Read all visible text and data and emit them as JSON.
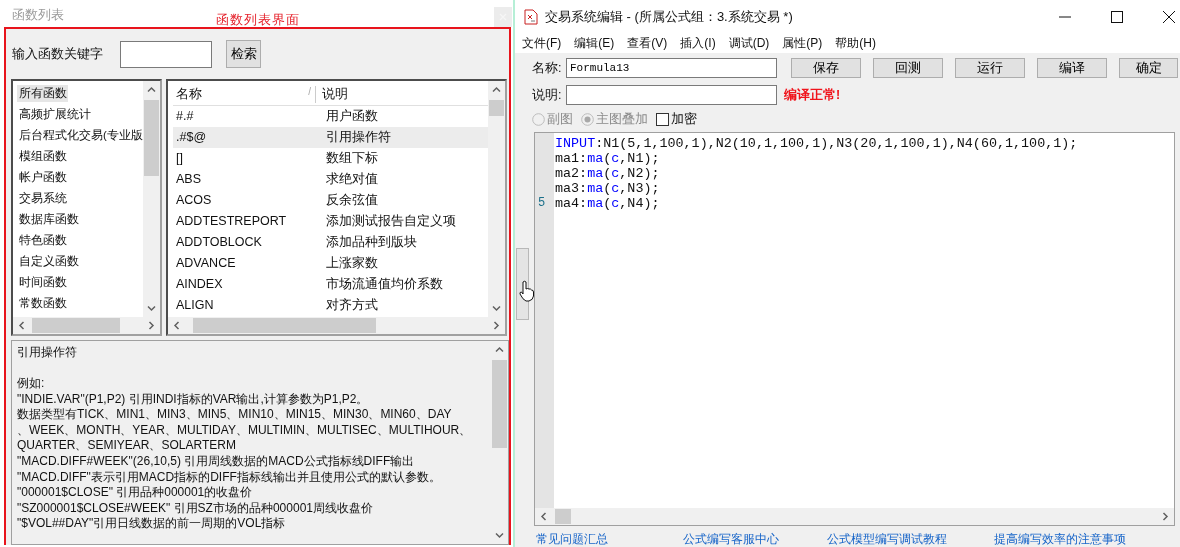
{
  "left_panel": {
    "title": "函数列表",
    "annotation": "函数列表界面",
    "search": {
      "label": "输入函数关键字",
      "button": "检索"
    },
    "categories": [
      {
        "label": "所有函数",
        "selected": true
      },
      {
        "label": "高频扩展统计",
        "selected": false
      },
      {
        "label": "后台程式化交易(专业版",
        "selected": false
      },
      {
        "label": "模组函数",
        "selected": false
      },
      {
        "label": "帐户函数",
        "selected": false
      },
      {
        "label": "交易系统",
        "selected": false
      },
      {
        "label": "数据库函数",
        "selected": false
      },
      {
        "label": "特色函数",
        "selected": false
      },
      {
        "label": "自定义函数",
        "selected": false
      },
      {
        "label": "时间函数",
        "selected": false
      },
      {
        "label": "常数函数",
        "selected": false
      }
    ],
    "functions": {
      "columns": [
        "名称",
        "说明"
      ],
      "sort_mark": "/",
      "rows": [
        {
          "name": "#.#",
          "description": "用户函数",
          "selected": false
        },
        {
          "name": ".#$@",
          "description": "引用操作符",
          "selected": true
        },
        {
          "name": "[]",
          "description": "数组下标",
          "selected": false
        },
        {
          "name": "ABS",
          "description": "求绝对值",
          "selected": false
        },
        {
          "name": "ACOS",
          "description": "反余弦值",
          "selected": false
        },
        {
          "name": "ADDTESTREPORT",
          "description": "添加测试报告自定义项",
          "selected": false
        },
        {
          "name": "ADDTOBLOCK",
          "description": "添加品种到版块",
          "selected": false
        },
        {
          "name": "ADVANCE",
          "description": "上涨家数",
          "selected": false
        },
        {
          "name": "AINDEX",
          "description": "市场流通值均价系数",
          "selected": false
        },
        {
          "name": "ALIGN",
          "description": "对齐方式",
          "selected": false
        }
      ]
    },
    "description": {
      "heading": "引用操作符",
      "lines": [
        "例如:",
        "\"INDIE.VAR\"(P1,P2) 引用INDI指标的VAR输出,计算参数为P1,P2。",
        "数据类型有TICK、MIN1、MIN3、MIN5、MIN10、MIN15、MIN30、MIN60、DAY",
        "、WEEK、MONTH、YEAR、MULTIDAY、MULTIMIN、MULTISEC、MULTIHOUR、",
        "QUARTER、SEMIYEAR、SOLARTERM",
        "\"MACD.DIFF#WEEK\"(26,10,5) 引用周线数据的MACD公式指标线DIFF输出",
        "\"MACD.DIFF\"表示引用MACD指标的DIFF指标线输出并且使用公式的默认参数。",
        "\"000001$CLOSE\" 引用品种000001的收盘价",
        "\"SZ000001$CLOSE#WEEK\" 引用SZ市场的品种000001周线收盘价",
        "\"$VOL##DAY\"引用日线数据的前一周期的VOL指标"
      ]
    }
  },
  "editor_window": {
    "title": "交易系统编辑 - (所属公式组：3.系统交易 *)",
    "menu": [
      "文件(F)",
      "编辑(E)",
      "查看(V)",
      "插入(I)",
      "调试(D)",
      "属性(P)",
      "帮助(H)"
    ],
    "name_field": {
      "label": "名称:",
      "value": "Formula13"
    },
    "buttons": [
      "保存",
      "回测",
      "运行",
      "编译",
      "确定"
    ],
    "note_field": {
      "label": "说明:"
    },
    "status": "编译正常!",
    "options": [
      {
        "kind": "radio",
        "label": "副图",
        "selected": false,
        "disabled": true
      },
      {
        "kind": "radio",
        "label": "主图叠加",
        "selected": true,
        "disabled": true
      },
      {
        "kind": "checkbox",
        "label": "加密",
        "checked": false
      }
    ],
    "code": [
      {
        "tokens": [
          {
            "kind": "keyword",
            "text": "INPUT"
          },
          {
            "kind": "plain",
            "text": ":N1(5,1,100,1),N2(10,1,100,1),N3(20,1,100,1),N4(60,1,100,1);"
          }
        ]
      },
      {
        "tokens": [
          {
            "kind": "plain",
            "text": "ma1:"
          },
          {
            "kind": "keyword",
            "text": "ma"
          },
          {
            "kind": "plain",
            "text": "("
          },
          {
            "kind": "keyword",
            "text": "c"
          },
          {
            "kind": "plain",
            "text": ",N1);"
          }
        ]
      },
      {
        "tokens": [
          {
            "kind": "plain",
            "text": "ma2:"
          },
          {
            "kind": "keyword",
            "text": "ma"
          },
          {
            "kind": "plain",
            "text": "("
          },
          {
            "kind": "keyword",
            "text": "c"
          },
          {
            "kind": "plain",
            "text": ",N2);"
          }
        ]
      },
      {
        "tokens": [
          {
            "kind": "plain",
            "text": "ma3:"
          },
          {
            "kind": "keyword",
            "text": "ma"
          },
          {
            "kind": "plain",
            "text": "("
          },
          {
            "kind": "keyword",
            "text": "c"
          },
          {
            "kind": "plain",
            "text": ",N3);"
          }
        ]
      },
      {
        "line_number": "5",
        "tokens": [
          {
            "kind": "plain",
            "text": "ma4:"
          },
          {
            "kind": "keyword",
            "text": "ma"
          },
          {
            "kind": "plain",
            "text": "("
          },
          {
            "kind": "keyword",
            "text": "c"
          },
          {
            "kind": "plain",
            "text": ",N4);"
          }
        ]
      }
    ],
    "links": [
      "常见问题汇总",
      "公式编写客服中心",
      "公式模型编写调试教程",
      "提高编写效率的注意事项"
    ]
  }
}
